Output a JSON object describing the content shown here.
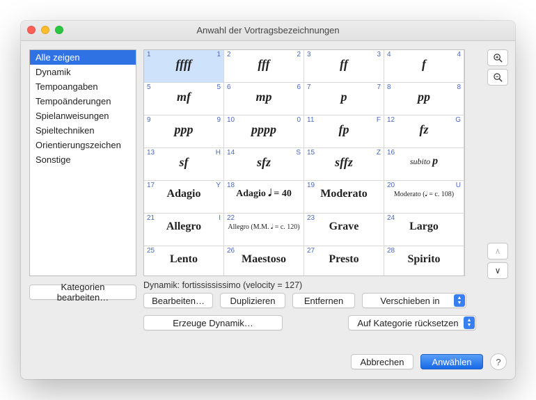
{
  "title": "Anwahl der Vortragsbezeichnungen",
  "sidebar": {
    "items": [
      {
        "label": "Alle zeigen",
        "selected": true
      },
      {
        "label": "Dynamik"
      },
      {
        "label": "Tempoangaben"
      },
      {
        "label": "Tempoänderungen"
      },
      {
        "label": "Spielanweisungen"
      },
      {
        "label": "Spieltechniken"
      },
      {
        "label": "Orientierungszeichen"
      },
      {
        "label": "Sonstige"
      }
    ],
    "edit_label": "Kategorien bearbeiten…"
  },
  "grid": [
    {
      "idx": "1",
      "key": "1",
      "label": "ffff",
      "style": "dyn",
      "selected": true
    },
    {
      "idx": "2",
      "key": "2",
      "label": "fff",
      "style": "dyn"
    },
    {
      "idx": "3",
      "key": "3",
      "label": "ff",
      "style": "dyn"
    },
    {
      "idx": "4",
      "key": "4",
      "label": "f",
      "style": "dyn"
    },
    {
      "idx": "5",
      "key": "5",
      "label": "mf",
      "style": "dyn"
    },
    {
      "idx": "6",
      "key": "6",
      "label": "mp",
      "style": "dyn"
    },
    {
      "idx": "7",
      "key": "7",
      "label": "p",
      "style": "dyn"
    },
    {
      "idx": "8",
      "key": "8",
      "label": "pp",
      "style": "dyn"
    },
    {
      "idx": "9",
      "key": "9",
      "label": "ppp",
      "style": "dyn"
    },
    {
      "idx": "10",
      "key": "0",
      "label": "pppp",
      "style": "dyn"
    },
    {
      "idx": "11",
      "key": "F",
      "label": "fp",
      "style": "dyn"
    },
    {
      "idx": "12",
      "key": "G",
      "label": "fz",
      "style": "dyn"
    },
    {
      "idx": "13",
      "key": "H",
      "label": "sf",
      "style": "dyn"
    },
    {
      "idx": "14",
      "key": "S",
      "label": "sfz",
      "style": "dyn"
    },
    {
      "idx": "15",
      "key": "Z",
      "label": "sffz",
      "style": "dyn"
    },
    {
      "idx": "16",
      "key": "",
      "label": "subito p",
      "style": "subp"
    },
    {
      "idx": "17",
      "key": "Y",
      "label": "Adagio",
      "style": "lab"
    },
    {
      "idx": "18",
      "key": "",
      "label": "Adagio 𝅘𝅥 = 40",
      "style": "lab-sm"
    },
    {
      "idx": "19",
      "key": "",
      "label": "Moderato",
      "style": "lab"
    },
    {
      "idx": "20",
      "key": "U",
      "label": "Moderato  (𝅘𝅥 = c. 108)",
      "style": "sub"
    },
    {
      "idx": "21",
      "key": "I",
      "label": "Allegro",
      "style": "lab"
    },
    {
      "idx": "22",
      "key": "",
      "label": "Allegro  (M.M. 𝅘𝅥 = c. 120)",
      "style": "sub"
    },
    {
      "idx": "23",
      "key": "",
      "label": "Grave",
      "style": "lab"
    },
    {
      "idx": "24",
      "key": "",
      "label": "Largo",
      "style": "lab"
    },
    {
      "idx": "25",
      "key": "",
      "label": "Lento",
      "style": "lab"
    },
    {
      "idx": "26",
      "key": "",
      "label": "Maestoso",
      "style": "lab"
    },
    {
      "idx": "27",
      "key": "",
      "label": "Presto",
      "style": "lab"
    },
    {
      "idx": "28",
      "key": "",
      "label": "Spirito",
      "style": "lab"
    }
  ],
  "status": "Dynamik: fortissississimo (velocity = 127)",
  "buttons": {
    "edit": "Bearbeiten…",
    "duplicate": "Duplizieren",
    "remove": "Entfernen",
    "move": "Verschieben in",
    "create": "Erzeuge Dynamik…",
    "reset": "Auf Kategorie rücksetzen",
    "cancel": "Abbrechen",
    "select": "Anwählen",
    "help": "?"
  }
}
